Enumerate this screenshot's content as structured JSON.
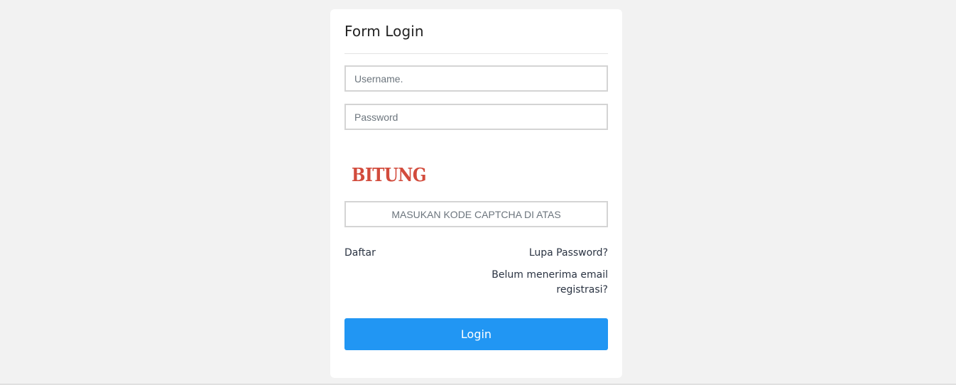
{
  "form": {
    "title": "Form Login",
    "username_placeholder": "Username.",
    "password_placeholder": "Password",
    "captcha_text": "BITUNG",
    "captcha_input_placeholder": "MASUKAN KODE CAPTCHA DI ATAS",
    "register_link": "Daftar",
    "forgot_password_link": "Lupa Password?",
    "resend_registration_link": "Belum menerima email registrasi?",
    "login_button": "Login"
  },
  "colors": {
    "background": "#f2f2f2",
    "card": "#ffffff",
    "primary": "#2196f3",
    "captcha": "#d24b3c"
  }
}
